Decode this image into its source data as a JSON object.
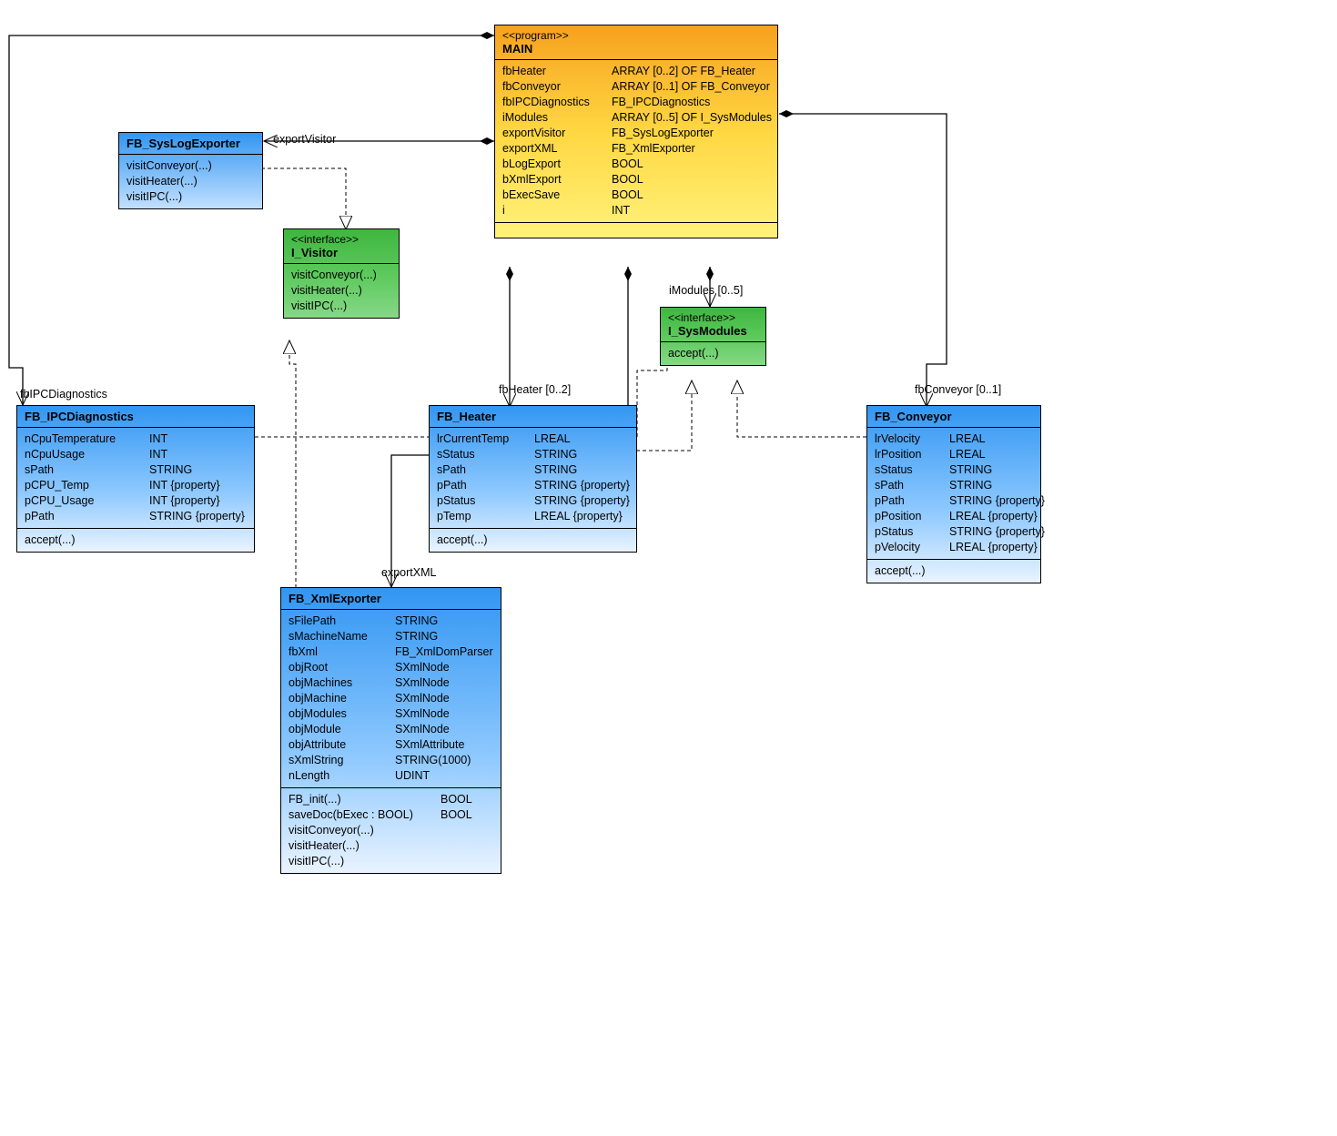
{
  "main": {
    "stereotype": "<<program>>",
    "title": "MAIN",
    "attrs": [
      {
        "name": "fbHeater",
        "type": "ARRAY [0..2] OF FB_Heater"
      },
      {
        "name": "fbConveyor",
        "type": "ARRAY [0..1] OF FB_Conveyor"
      },
      {
        "name": "fbIPCDiagnostics",
        "type": "FB_IPCDiagnostics"
      },
      {
        "name": "iModules",
        "type": "ARRAY [0..5] OF I_SysModules"
      },
      {
        "name": "exportVisitor",
        "type": "FB_SysLogExporter"
      },
      {
        "name": "exportXML",
        "type": "FB_XmlExporter"
      },
      {
        "name": "bLogExport",
        "type": "BOOL"
      },
      {
        "name": "bXmlExport",
        "type": "BOOL"
      },
      {
        "name": "bExecSave",
        "type": "BOOL"
      },
      {
        "name": "i",
        "type": "INT"
      }
    ]
  },
  "iVisitor": {
    "stereotype": "<<interface>>",
    "title": "I_Visitor",
    "ops": [
      "visitConveyor(...)",
      "visitHeater(...)",
      "visitIPC(...)"
    ]
  },
  "iSysModules": {
    "stereotype": "<<interface>>",
    "title": "I_SysModules",
    "ops": [
      "accept(...)"
    ]
  },
  "syslog": {
    "title": "FB_SysLogExporter",
    "ops": [
      "visitConveyor(...)",
      "visitHeater(...)",
      "visitIPC(...)"
    ]
  },
  "ipc": {
    "title": "FB_IPCDiagnostics",
    "attrs": [
      {
        "name": "nCpuTemperature",
        "type": "INT"
      },
      {
        "name": "nCpuUsage",
        "type": "INT"
      },
      {
        "name": "sPath",
        "type": "STRING"
      },
      {
        "name": "pCPU_Temp",
        "type": "INT {property}"
      },
      {
        "name": "pCPU_Usage",
        "type": "INT {property}"
      },
      {
        "name": "pPath",
        "type": "STRING {property}"
      }
    ],
    "ops": [
      "accept(...)"
    ]
  },
  "heater": {
    "title": "FB_Heater",
    "attrs": [
      {
        "name": "lrCurrentTemp",
        "type": "LREAL"
      },
      {
        "name": "sStatus",
        "type": "STRING"
      },
      {
        "name": "sPath",
        "type": "STRING"
      },
      {
        "name": "pPath",
        "type": "STRING {property}"
      },
      {
        "name": "pStatus",
        "type": "STRING {property}"
      },
      {
        "name": "pTemp",
        "type": "LREAL {property}"
      }
    ],
    "ops": [
      "accept(...)"
    ]
  },
  "conveyor": {
    "title": "FB_Conveyor",
    "attrs": [
      {
        "name": "lrVelocity",
        "type": "LREAL"
      },
      {
        "name": "lrPosition",
        "type": "LREAL"
      },
      {
        "name": "sStatus",
        "type": "STRING"
      },
      {
        "name": "sPath",
        "type": "STRING"
      },
      {
        "name": "pPath",
        "type": "STRING {property}"
      },
      {
        "name": "pPosition",
        "type": "LREAL {property}"
      },
      {
        "name": "pStatus",
        "type": "STRING {property}"
      },
      {
        "name": "pVelocity",
        "type": "LREAL {property}"
      }
    ],
    "ops": [
      "accept(...)"
    ]
  },
  "xml": {
    "title": "FB_XmlExporter",
    "attrs": [
      {
        "name": "sFilePath",
        "type": "STRING"
      },
      {
        "name": "sMachineName",
        "type": "STRING"
      },
      {
        "name": "fbXml",
        "type": "FB_XmlDomParser"
      },
      {
        "name": "objRoot",
        "type": "SXmlNode"
      },
      {
        "name": "objMachines",
        "type": "SXmlNode"
      },
      {
        "name": "objMachine",
        "type": "SXmlNode"
      },
      {
        "name": "objModules",
        "type": "SXmlNode"
      },
      {
        "name": "objModule",
        "type": "SXmlNode"
      },
      {
        "name": "objAttribute",
        "type": "SXmlAttribute"
      },
      {
        "name": "sXmlString",
        "type": "STRING(1000)"
      },
      {
        "name": "nLength",
        "type": "UDINT"
      }
    ],
    "ops": [
      {
        "sig": "FB_init(...)",
        "ret": "BOOL"
      },
      {
        "sig": "saveDoc(bExec : BOOL)",
        "ret": "BOOL"
      },
      {
        "sig": "visitConveyor(...)",
        "ret": ""
      },
      {
        "sig": "visitHeater(...)",
        "ret": ""
      },
      {
        "sig": "visitIPC(...)",
        "ret": ""
      }
    ]
  },
  "labels": {
    "exportVisitor": "exportVisitor",
    "iModules": "iModules [0..5]",
    "fbHeater": "fbHeater [0..2]",
    "fbConveyor": "fbConveyor [0..1]",
    "fbIPCDiagnostics": "fbIPCDiagnostics",
    "exportXML": "exportXML"
  }
}
